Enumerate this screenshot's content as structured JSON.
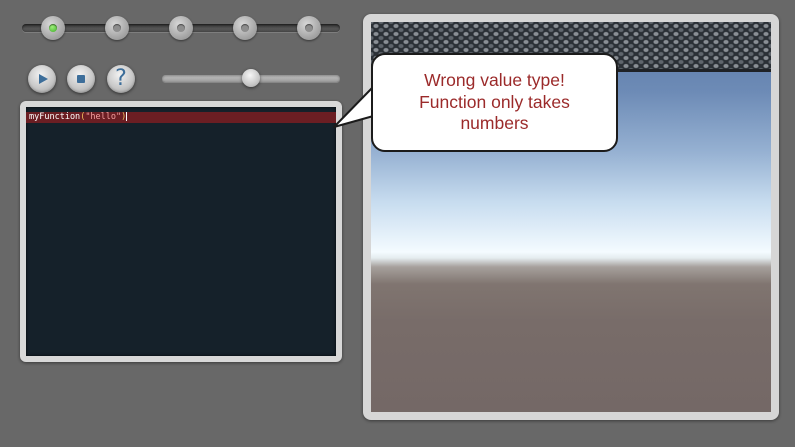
{
  "levels": [
    {
      "state": "current"
    },
    {
      "state": "locked"
    },
    {
      "state": "locked"
    },
    {
      "state": "locked"
    },
    {
      "state": "locked"
    }
  ],
  "controls": {
    "play_icon": "play-icon",
    "stop_icon": "stop-icon",
    "help_label": "?"
  },
  "speed_slider": {
    "value_fraction": 0.5
  },
  "code_editor": {
    "lines": [
      {
        "function_name": "myFunction",
        "open_paren": "(",
        "argument": "\"hello\"",
        "close_paren": ")",
        "error": true
      }
    ]
  },
  "tooltip": {
    "message": "Wrong value type!\nFunction only takes\nnumbers"
  },
  "colors": {
    "background": "#686868",
    "editor_background": "#15212a",
    "error_line_highlight": "#6b1e23",
    "button_icon": "#3d6e9a",
    "active_level": "#3fae2a",
    "tooltip_text": "#9b2a2a"
  }
}
